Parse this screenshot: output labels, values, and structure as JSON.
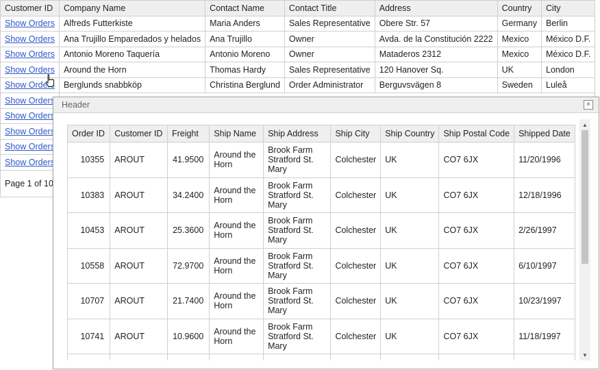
{
  "main_grid": {
    "columns": [
      "Customer ID",
      "Company Name",
      "Contact Name",
      "Contact Title",
      "Address",
      "Country",
      "City"
    ],
    "link_label": "Show Orders",
    "rows": [
      {
        "company": "Alfreds Futterkiste",
        "contact": "Maria Anders",
        "title": "Sales Representative",
        "address": "Obere Str. 57",
        "country": "Germany",
        "city": "Berlin"
      },
      {
        "company": "Ana Trujillo Emparedados y helados",
        "contact": "Ana Trujillo",
        "title": "Owner",
        "address": "Avda. de la Constitución 2222",
        "country": "Mexico",
        "city": "México D.F."
      },
      {
        "company": "Antonio Moreno Taquería",
        "contact": "Antonio Moreno",
        "title": "Owner",
        "address": "Mataderos 2312",
        "country": "Mexico",
        "city": "México D.F."
      },
      {
        "company": "Around the Horn",
        "contact": "Thomas Hardy",
        "title": "Sales Representative",
        "address": "120 Hanover Sq.",
        "country": "UK",
        "city": "London"
      },
      {
        "company": "Berglunds snabbköp",
        "contact": "Christina Berglund",
        "title": "Order Administrator",
        "address": "Berguvsvägen 8",
        "country": "Sweden",
        "city": "Luleå"
      },
      {},
      {},
      {},
      {},
      {}
    ],
    "pager": "Page 1 of 10"
  },
  "popup": {
    "title": "Header",
    "close_glyph": "×",
    "columns": [
      "Order ID",
      "Customer ID",
      "Freight",
      "Ship Name",
      "Ship Address",
      "Ship City",
      "Ship Country",
      "Ship Postal Code",
      "Shipped Date"
    ],
    "rows": [
      {
        "order_id": "10355",
        "customer_id": "AROUT",
        "freight": "41.9500",
        "ship_name": "Around the Horn",
        "ship_address": "Brook Farm Stratford St. Mary",
        "ship_city": "Colchester",
        "ship_country": "UK",
        "postal": "CO7 6JX",
        "shipped": "11/20/1996"
      },
      {
        "order_id": "10383",
        "customer_id": "AROUT",
        "freight": "34.2400",
        "ship_name": "Around the Horn",
        "ship_address": "Brook Farm Stratford St. Mary",
        "ship_city": "Colchester",
        "ship_country": "UK",
        "postal": "CO7 6JX",
        "shipped": "12/18/1996"
      },
      {
        "order_id": "10453",
        "customer_id": "AROUT",
        "freight": "25.3600",
        "ship_name": "Around the Horn",
        "ship_address": "Brook Farm Stratford St. Mary",
        "ship_city": "Colchester",
        "ship_country": "UK",
        "postal": "CO7 6JX",
        "shipped": "2/26/1997"
      },
      {
        "order_id": "10558",
        "customer_id": "AROUT",
        "freight": "72.9700",
        "ship_name": "Around the Horn",
        "ship_address": "Brook Farm Stratford St. Mary",
        "ship_city": "Colchester",
        "ship_country": "UK",
        "postal": "CO7 6JX",
        "shipped": "6/10/1997"
      },
      {
        "order_id": "10707",
        "customer_id": "AROUT",
        "freight": "21.7400",
        "ship_name": "Around the Horn",
        "ship_address": "Brook Farm Stratford St. Mary",
        "ship_city": "Colchester",
        "ship_country": "UK",
        "postal": "CO7 6JX",
        "shipped": "10/23/1997"
      },
      {
        "order_id": "10741",
        "customer_id": "AROUT",
        "freight": "10.9600",
        "ship_name": "Around the Horn",
        "ship_address": "Brook Farm Stratford St. Mary",
        "ship_city": "Colchester",
        "ship_country": "UK",
        "postal": "CO7 6JX",
        "shipped": "11/18/1997"
      }
    ]
  },
  "colors": {
    "link": "#2b58c8",
    "header_bg": "#efefef",
    "border": "#cfcfcf",
    "scroll_thumb": "#c4c4c4"
  }
}
